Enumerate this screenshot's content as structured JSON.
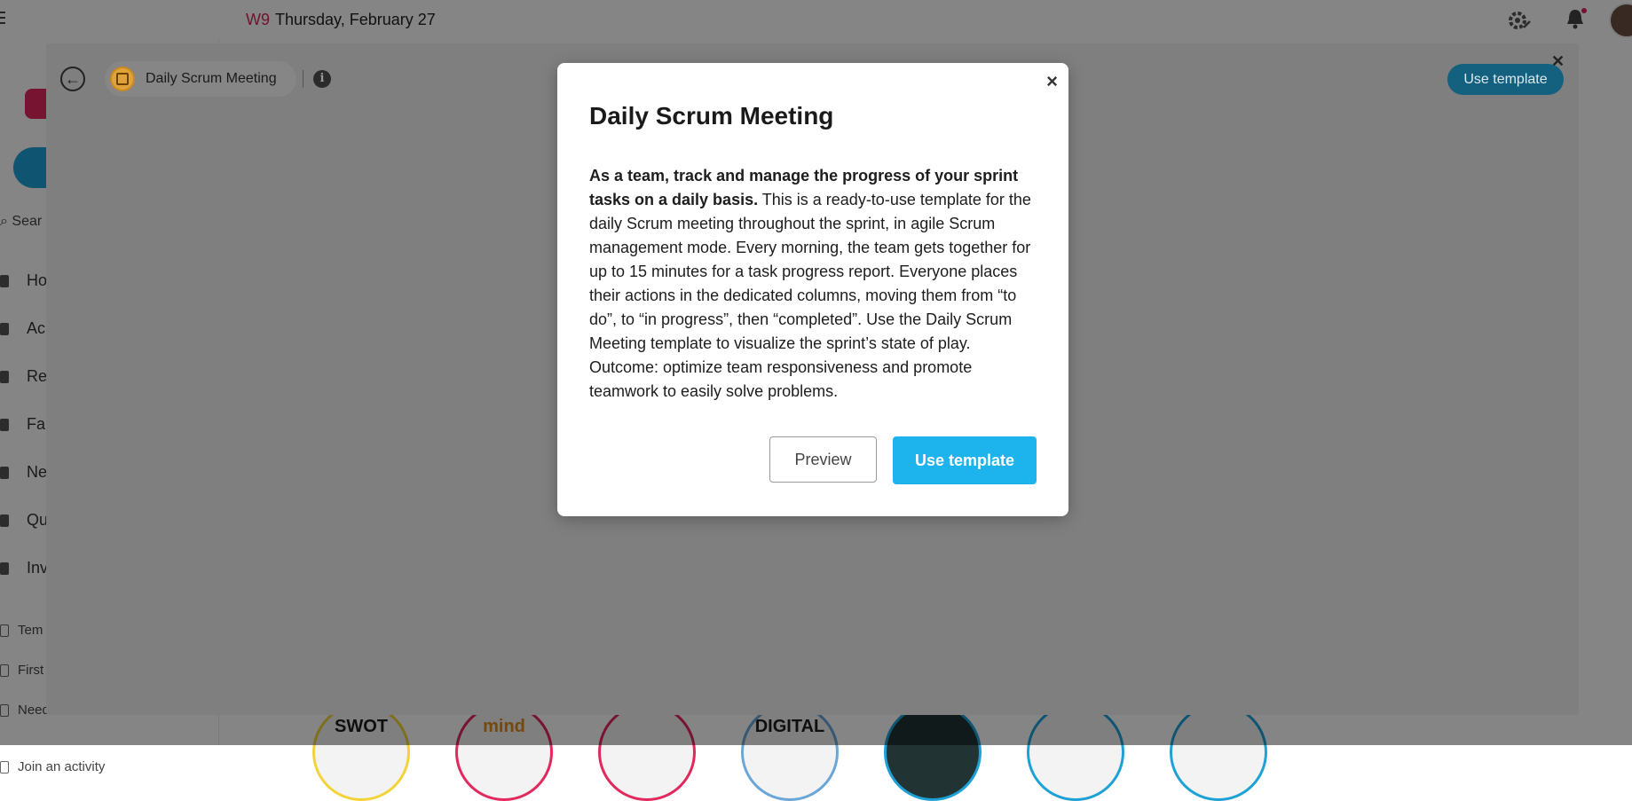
{
  "header": {
    "week": "W9",
    "date": "Thursday, February 27"
  },
  "sidebar": {
    "search_label": "Sear",
    "items": [
      {
        "label": "Ho"
      },
      {
        "label": "Ac"
      },
      {
        "label": "Re"
      },
      {
        "label": "Fa"
      },
      {
        "label": "Ne"
      },
      {
        "label": "Qu"
      },
      {
        "label": "Inv"
      }
    ],
    "secondary": [
      {
        "label": "Tem"
      },
      {
        "label": "First"
      },
      {
        "label": "Need"
      },
      {
        "label": "Join an activity"
      }
    ]
  },
  "thumbnails": [
    "SWOT",
    "mind",
    "",
    "DIGITAL",
    "",
    "",
    ""
  ],
  "panel": {
    "template_name": "Daily Scrum Meeting",
    "info_glyph": "i",
    "use_template_label": "Use template",
    "close_glyph": "✕",
    "back_glyph": "←"
  },
  "modal": {
    "title": "Daily Scrum Meeting",
    "close_glyph": "×",
    "description_bold": "As a team, track and manage the progress of your sprint tasks on a daily basis.",
    "description_rest": " This is a ready-to-use template for the daily Scrum meeting throughout the sprint, in agile Scrum management mode. Every morning, the team gets together for up to 15 minutes for a task progress report. Everyone places their actions in the dedicated columns, moving them from “to do”, to “in progress”, then “completed”. Use the Daily Scrum Meeting template to visualize the sprint’s state of play. Outcome: optimize team responsiveness and promote teamwork to easily solve problems.",
    "preview_label": "Preview",
    "use_template_label": "Use template"
  },
  "colors": {
    "accent": "#1db4ee",
    "brand": "#e3285e",
    "week": "#d8285a"
  }
}
